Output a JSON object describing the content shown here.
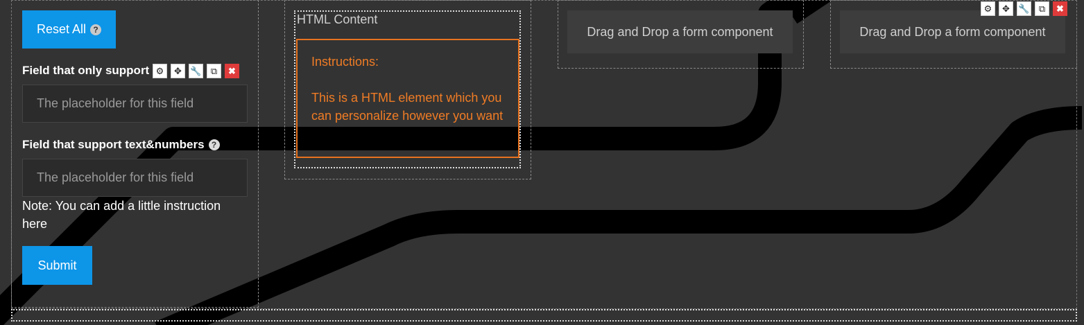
{
  "left_column": {
    "reset_button": {
      "label": "Reset All",
      "help_icon": "question-circle-icon"
    },
    "field1": {
      "label": "Field that only support",
      "placeholder": "The placeholder for this field"
    },
    "field2": {
      "label": "Field that support text&numbers",
      "help_icon": "question-circle-icon",
      "placeholder": "The placeholder for this field"
    },
    "note": "Note: You can add a little instruction here",
    "submit_label": "Submit"
  },
  "toolbar": {
    "icons": [
      "gear-icon",
      "move-icon",
      "wrench-icon",
      "copy-icon",
      "close-icon"
    ],
    "glyphs": [
      "⚙",
      "✥",
      "🔧",
      "⧉",
      "✖"
    ]
  },
  "html_block": {
    "title": "HTML Content",
    "instructions_title": "Instructions:",
    "instructions_body": "This is a HTML element which you can personalize however you want"
  },
  "drop_zones": [
    {
      "label": "Drag and Drop a form component"
    },
    {
      "label": "Drag and Drop a form component"
    }
  ],
  "colors": {
    "background": "#333333",
    "accent_blue": "#0d95e8",
    "html_orange": "#e8731f",
    "delete_red": "#e03b3b"
  }
}
